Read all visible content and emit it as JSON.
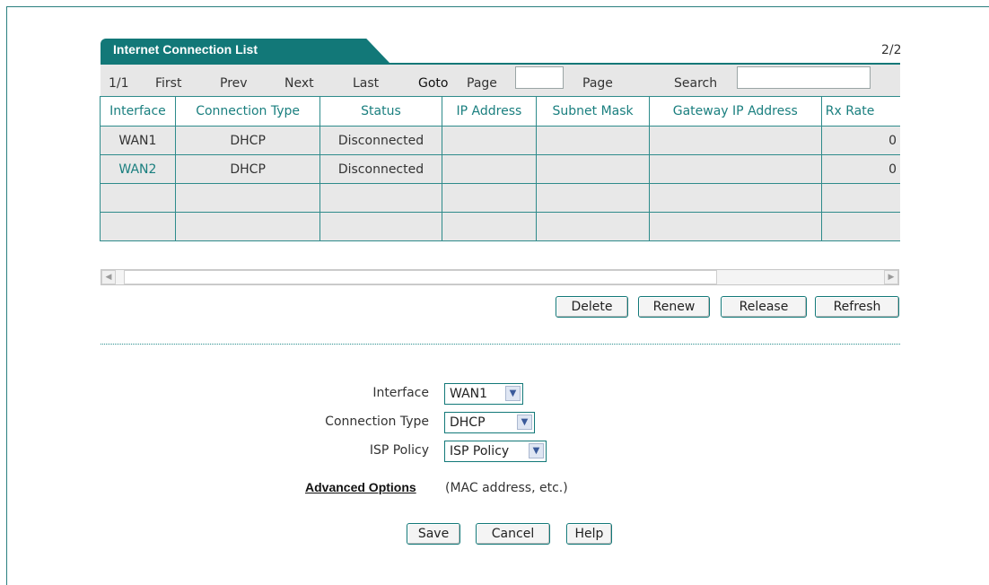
{
  "list": {
    "title": "Internet Connection List",
    "page_count": "2/2"
  },
  "nav": {
    "position": "1/1",
    "first": "First",
    "prev": "Prev",
    "next": "Next",
    "last": "Last",
    "goto": "Goto",
    "page_prefix": "Page",
    "page_input_value": "",
    "page_suffix": "Page",
    "search_label": "Search",
    "search_value": ""
  },
  "table": {
    "headers": [
      "Interface",
      "Connection Type",
      "Status",
      "IP Address",
      "Subnet Mask",
      "Gateway IP Address",
      "Rx Rate"
    ],
    "rows": [
      [
        "WAN1",
        "DHCP",
        "Disconnected",
        "",
        "",
        "",
        "0"
      ],
      [
        "WAN2",
        "DHCP",
        "Disconnected",
        "",
        "",
        "",
        "0"
      ],
      [
        "",
        "",
        "",
        "",
        "",
        "",
        ""
      ],
      [
        "",
        "",
        "",
        "",
        "",
        "",
        ""
      ]
    ]
  },
  "actions": {
    "delete": "Delete",
    "renew": "Renew",
    "release": "Release",
    "refresh": "Refresh"
  },
  "form": {
    "interface_label": "Interface",
    "interface_value": "WAN1",
    "connection_type_label": "Connection Type",
    "connection_type_value": "DHCP",
    "isp_policy_label": "ISP Policy",
    "isp_policy_value": "ISP Policy",
    "advanced_link": "Advanced Options",
    "advanced_note": "(MAC address, etc.)"
  },
  "footer": {
    "save": "Save",
    "cancel": "Cancel",
    "help": "Help"
  },
  "colors": {
    "accent": "#127878",
    "link_teal": "#1a7f7f",
    "row_bg": "#e8e8e8"
  }
}
